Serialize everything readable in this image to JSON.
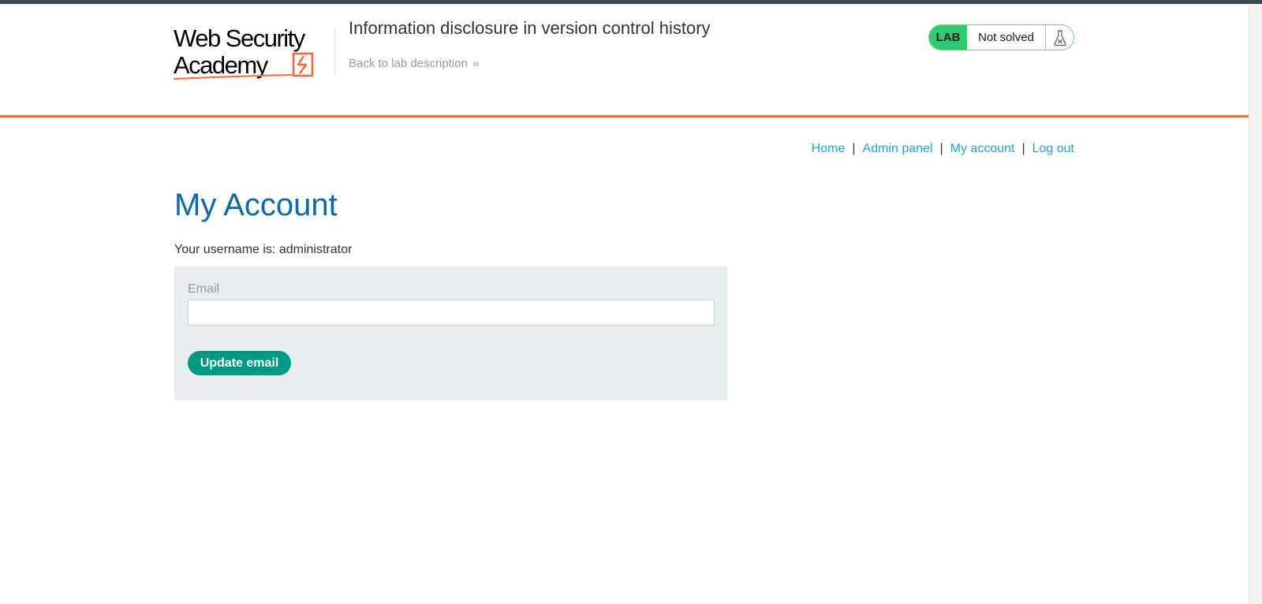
{
  "brand": {
    "logo_line1": "Web Security",
    "logo_line2": "Academy"
  },
  "header": {
    "lab_title": "Information disclosure in version control history",
    "back_link": "Back to lab description",
    "back_chevron": "»",
    "status": {
      "lab_badge": "LAB",
      "status_text": "Not solved",
      "icon": "flask-icon"
    }
  },
  "nav": {
    "items": [
      {
        "label": "Home"
      },
      {
        "label": "Admin panel"
      },
      {
        "label": "My account"
      },
      {
        "label": "Log out"
      }
    ],
    "separator": "|"
  },
  "main": {
    "heading": "My Account",
    "username_line": "Your username is: administrator",
    "form": {
      "email_label": "Email",
      "email_value": "",
      "submit_label": "Update email"
    }
  },
  "colors": {
    "accent_orange": "#ff6633",
    "heading_blue": "#0a6ab1",
    "link_blue": "#1ba5e1",
    "button_green": "#009a84",
    "lab_badge_green": "#2ecc71",
    "form_background": "#e8edf0"
  }
}
